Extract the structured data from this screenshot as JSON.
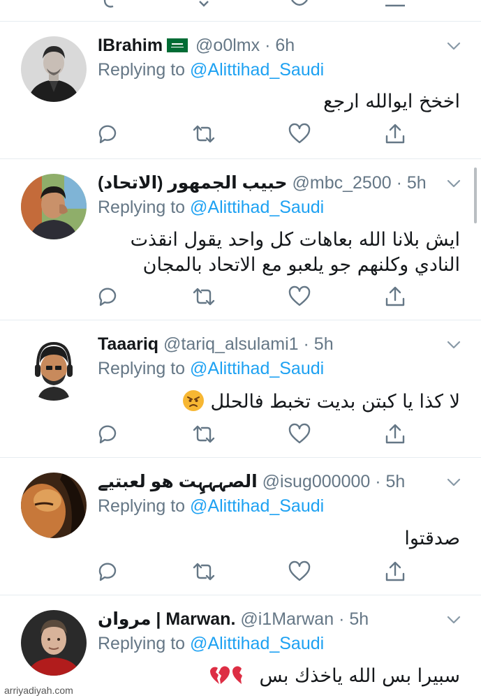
{
  "replying_prefix": "Replying to",
  "replying_to": "@Alittihad_Saudi",
  "tweets": [
    {
      "name": "IBrahim",
      "handle": "@o0lmx",
      "separator": "·",
      "time": "6h",
      "text": "اخخخ ايوالله ارجع",
      "avatar_icon": "profile-photo-man-dark-jacket",
      "has_flag": true,
      "flag_icon": "saudi-flag-emoji"
    },
    {
      "name": "حبيب الجمهور (الاتحاد)",
      "handle": "@mbc_2500",
      "separator": "·",
      "time": "5h",
      "text_line1": "ايش بلانا الله بعاهات كل واحد يقول انقذت",
      "text_line2": "النادي  وكلنهم جو يلعبو مع الاتحاد بالمجان",
      "avatar_icon": "profile-photo-young-man"
    },
    {
      "name": "Taaariq",
      "handle": "@tariq_alsulami1",
      "separator": "·",
      "time": "5h",
      "text": "لا كذا يا كبتن بديت تخبط فالحلل",
      "emoji": "angry-face-emoji",
      "avatar_icon": "bitmoji-avatar-headphones"
    },
    {
      "name": "الصہہہِت هو لعبتيے",
      "handle": "@isug000000",
      "separator": "·",
      "time": "5h",
      "text": "صدقتوا",
      "avatar_icon": "profile-photo-dim"
    },
    {
      "name": "مروان | Marwan.",
      "handle": "@i1Marwan",
      "separator": "·",
      "time": "5h",
      "text": "سبيرا بس الله ياخذك بس",
      "emoji": "broken-heart-emoji",
      "avatar_icon": "profile-photo-footballer"
    }
  ],
  "action_icons": [
    "reply-icon",
    "retweet-icon",
    "like-icon",
    "share-icon"
  ],
  "watermark": "arriyadiyah.com",
  "colors": {
    "link": "#1da1f2",
    "muted": "#657786",
    "text": "#14171a",
    "divider": "#e6ecf0"
  }
}
